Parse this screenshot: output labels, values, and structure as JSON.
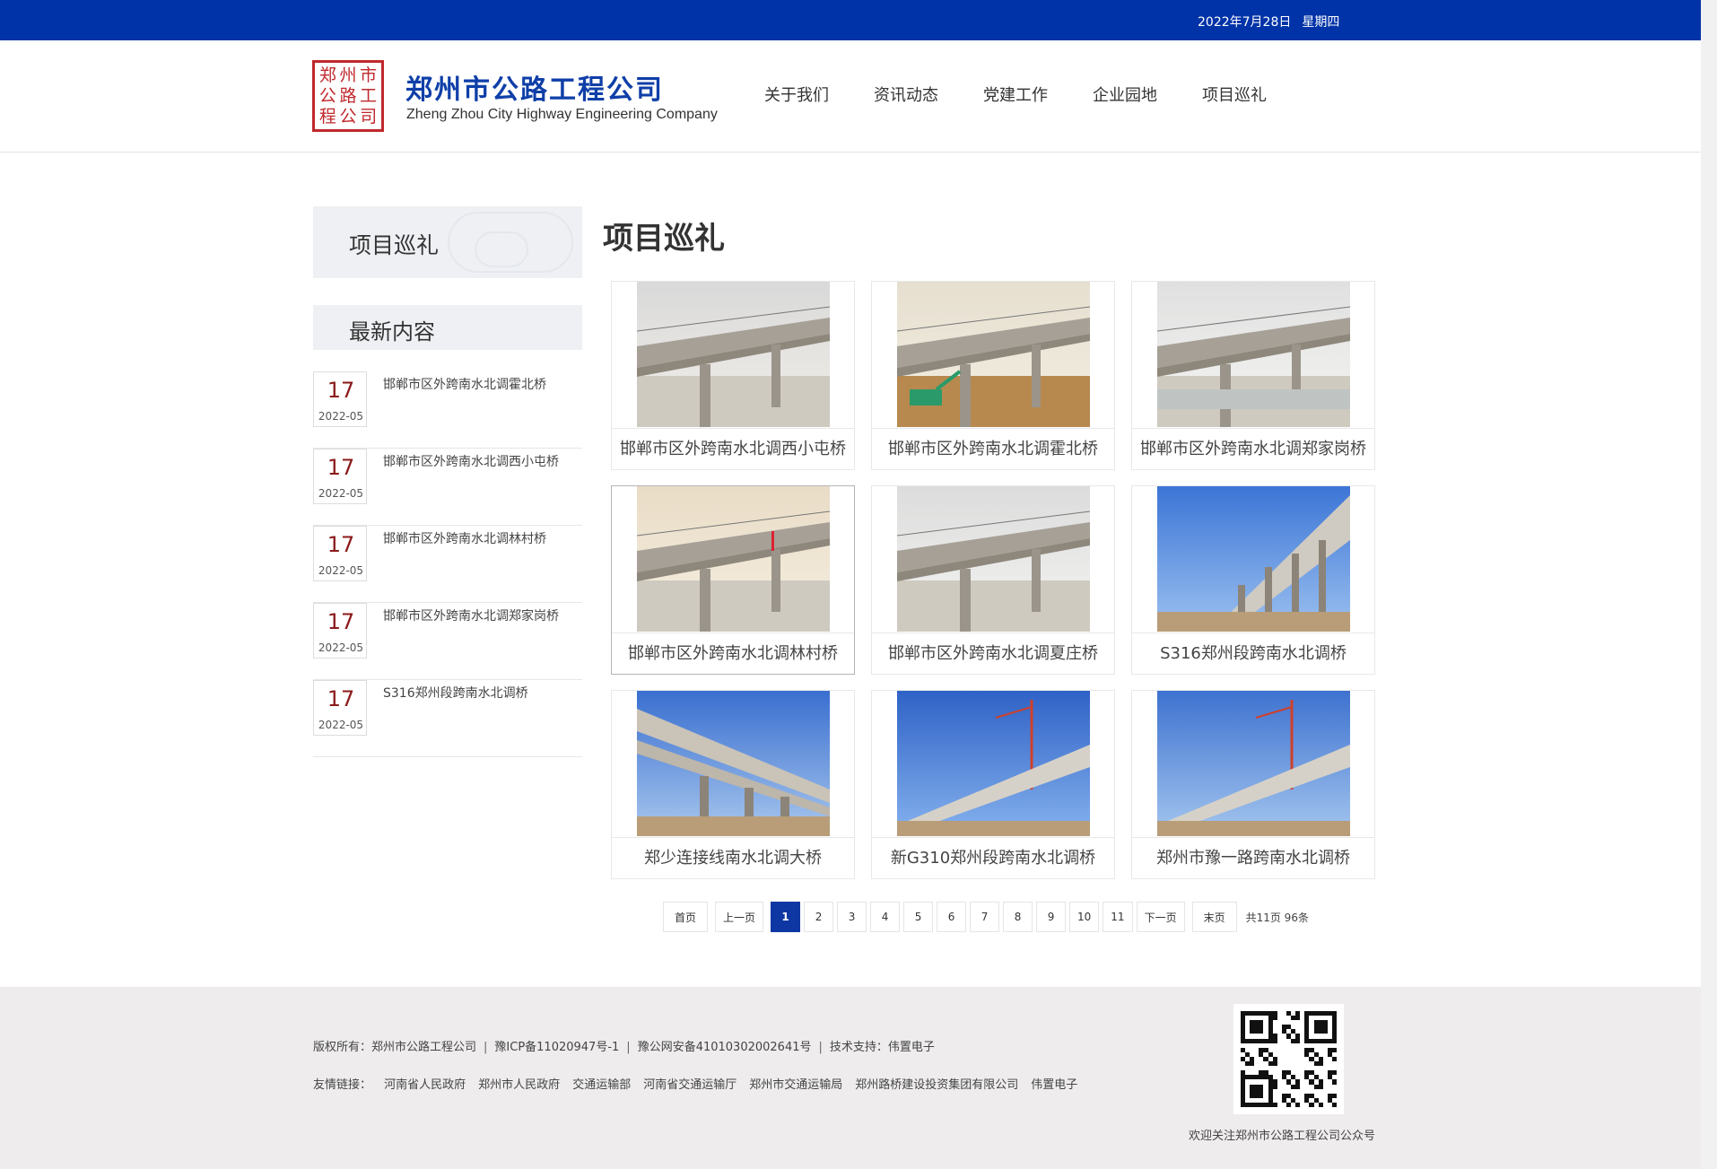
{
  "topbar": {
    "date": "2022年7月28日",
    "weekday": "星期四"
  },
  "brand": {
    "seal_chars": [
      "郑",
      "州",
      "市",
      "公",
      "路",
      "工",
      "程",
      "公",
      "司"
    ],
    "name_cn": "郑州市公路工程公司",
    "name_en": "Zheng Zhou City Highway Engineering Company"
  },
  "nav": [
    "关于我们",
    "资讯动态",
    "党建工作",
    "企业园地",
    "项目巡礼"
  ],
  "sidebar": {
    "title": "项目巡礼",
    "latest_title": "最新内容",
    "items": [
      {
        "day": "17",
        "ym": "2022-05",
        "title": "邯郸市区外跨南水北调霍北桥"
      },
      {
        "day": "17",
        "ym": "2022-05",
        "title": "邯郸市区外跨南水北调西小屯桥"
      },
      {
        "day": "17",
        "ym": "2022-05",
        "title": "邯郸市区外跨南水北调林村桥"
      },
      {
        "day": "17",
        "ym": "2022-05",
        "title": "邯郸市区外跨南水北调郑家岗桥"
      },
      {
        "day": "17",
        "ym": "2022-05",
        "title": "S316郑州段跨南水北调桥"
      }
    ]
  },
  "main": {
    "title": "项目巡礼",
    "projects": [
      {
        "caption": "邯郸市区外跨南水北调西小屯桥",
        "scene": "overcast"
      },
      {
        "caption": "邯郸市区外跨南水北调霍北桥",
        "scene": "construction"
      },
      {
        "caption": "邯郸市区外跨南水北调郑家岗桥",
        "scene": "canal"
      },
      {
        "caption": "邯郸市区外跨南水北调林村桥",
        "scene": "sunset"
      },
      {
        "caption": "邯郸市区外跨南水北调夏庄桥",
        "scene": "overcast2"
      },
      {
        "caption": "S316郑州段跨南水北调桥",
        "scene": "bluesky"
      },
      {
        "caption": "郑少连接线南水北调大桥",
        "scene": "underpass"
      },
      {
        "caption": "新G310郑州段跨南水北调桥",
        "scene": "crane"
      },
      {
        "caption": "郑州市豫一路跨南水北调桥",
        "scene": "crane2"
      }
    ]
  },
  "pagination": {
    "first": "首页",
    "prev": "上一页",
    "pages": [
      "1",
      "2",
      "3",
      "4",
      "5",
      "6",
      "7",
      "8",
      "9",
      "10",
      "11"
    ],
    "current": "1",
    "next": "下一页",
    "last": "末页",
    "total": "共11页 96条"
  },
  "footer": {
    "copyright": "版权所有：郑州市公路工程公司",
    "icp": "豫ICP备11020947号-1",
    "police": "豫公网安备41010302002641号",
    "support": "技术支持：伟置电子",
    "links_label": "友情链接：",
    "links": [
      "河南省人民政府",
      "郑州市人民政府",
      "交通运输部",
      "河南省交通运输厅",
      "郑州市交通运输局",
      "郑州路桥建设投资集团有限公司",
      "伟置电子"
    ],
    "qr_caption": "欢迎关注郑州市公路工程公司公众号"
  },
  "colors": {
    "topbar": "#0033a8",
    "brand": "#0f3fa8",
    "seal": "#c0282c",
    "date_day": "#8b1a1a",
    "footer_bg": "#eeecec"
  }
}
